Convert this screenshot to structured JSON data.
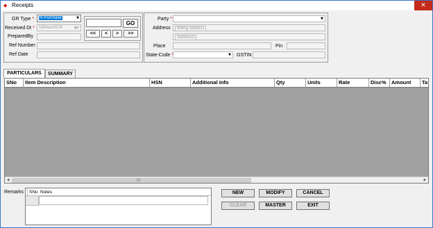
{
  "window": {
    "title": "Receipts",
    "close_glyph": "✕"
  },
  "header_left": {
    "gr_type_label": "GR Type",
    "gr_type_value": "R-Purchase",
    "received_dt_label": "Received Dt",
    "received_dt_value": "16/Nov/2019",
    "prepared_by_label": "PreparedBy",
    "ref_number_label": "Ref Number",
    "ref_date_label": "Ref Date",
    "required_mark": "*"
  },
  "nav": {
    "go_label": "GO",
    "first_label": "<<",
    "prev_label": "<",
    "next_label": ">",
    "last_label": ">>"
  },
  "header_right": {
    "party_label": "Party",
    "address_label": "Address",
    "billing_address_placeholder": "Billing Address",
    "address2_placeholder": "Address2",
    "place_label": "Place",
    "pin_label": "Pin",
    "state_code_label": "State-Code",
    "gstin_label": "GSTIN",
    "required_mark": "*"
  },
  "tabs": [
    {
      "label": "PARTICULARS",
      "active": true
    },
    {
      "label": "SUMMARY",
      "active": false
    }
  ],
  "grid": {
    "columns": [
      "SNo",
      "Item Description",
      "HSN",
      "Additional Info",
      "Qty",
      "Units",
      "Rate",
      "Disc%",
      "Amount",
      "Ta"
    ]
  },
  "remarks": {
    "label": "Remarks",
    "columns": [
      "SNo",
      "Notes"
    ]
  },
  "actions": {
    "new_label": "NEW",
    "modify_label": "MODIFY",
    "cancel_label": "CANCEL",
    "clear_label": "CLEAR",
    "master_label": "MASTER",
    "exit_label": "EXIT"
  },
  "colors": {
    "accent": "#3b74c6",
    "selection": "#0078d7",
    "required": "#e00000",
    "close": "#c42b1c",
    "grid_body": "#a0a0a0"
  }
}
